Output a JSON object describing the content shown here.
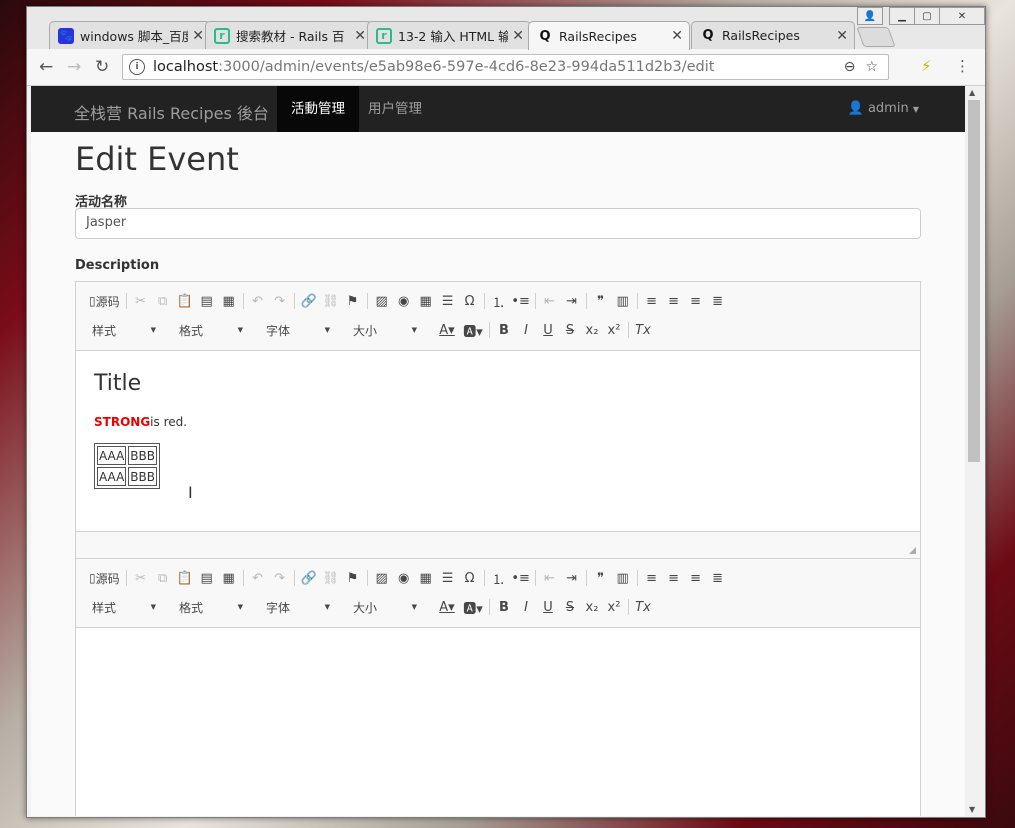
{
  "browser": {
    "tabs": [
      {
        "title": "windows 脚本_百度",
        "icon": "baidu-paw-icon",
        "color": "#2932e1"
      },
      {
        "title": "搜索教材 - Rails 百",
        "icon": "rails-recipes-icon",
        "color": "#2db98c"
      },
      {
        "title": "13-2 输入 HTML 输",
        "icon": "rails-recipes-icon",
        "color": "#2db98c"
      },
      {
        "title": "RailsRecipes",
        "icon": "q-icon",
        "active": true
      },
      {
        "title": "RailsRecipes",
        "icon": "q-icon"
      }
    ],
    "url_host": "localhost",
    "url_path": ":3000/admin/events/e5ab98e6-597e-4cd6-8e23-994da511d2b3/edit"
  },
  "app": {
    "brand": "全栈营 Rails Recipes 後台",
    "nav": [
      "活動管理",
      "用户管理"
    ],
    "user": "admin"
  },
  "form": {
    "heading": "Edit Event",
    "name_label": "活动名称",
    "name_value": "Jasper",
    "description_label": "Description"
  },
  "editor": {
    "source_label": "源码",
    "combos": [
      "样式",
      "格式",
      "字体",
      "大小"
    ],
    "content": {
      "title": "Title",
      "strong": "STRONG",
      "rest": "is red.",
      "table": [
        [
          "AAA",
          "BBB"
        ],
        [
          "AAA",
          "BBB"
        ]
      ]
    }
  },
  "colors": {
    "navbar": "#222222",
    "strong": "#ee0000"
  }
}
